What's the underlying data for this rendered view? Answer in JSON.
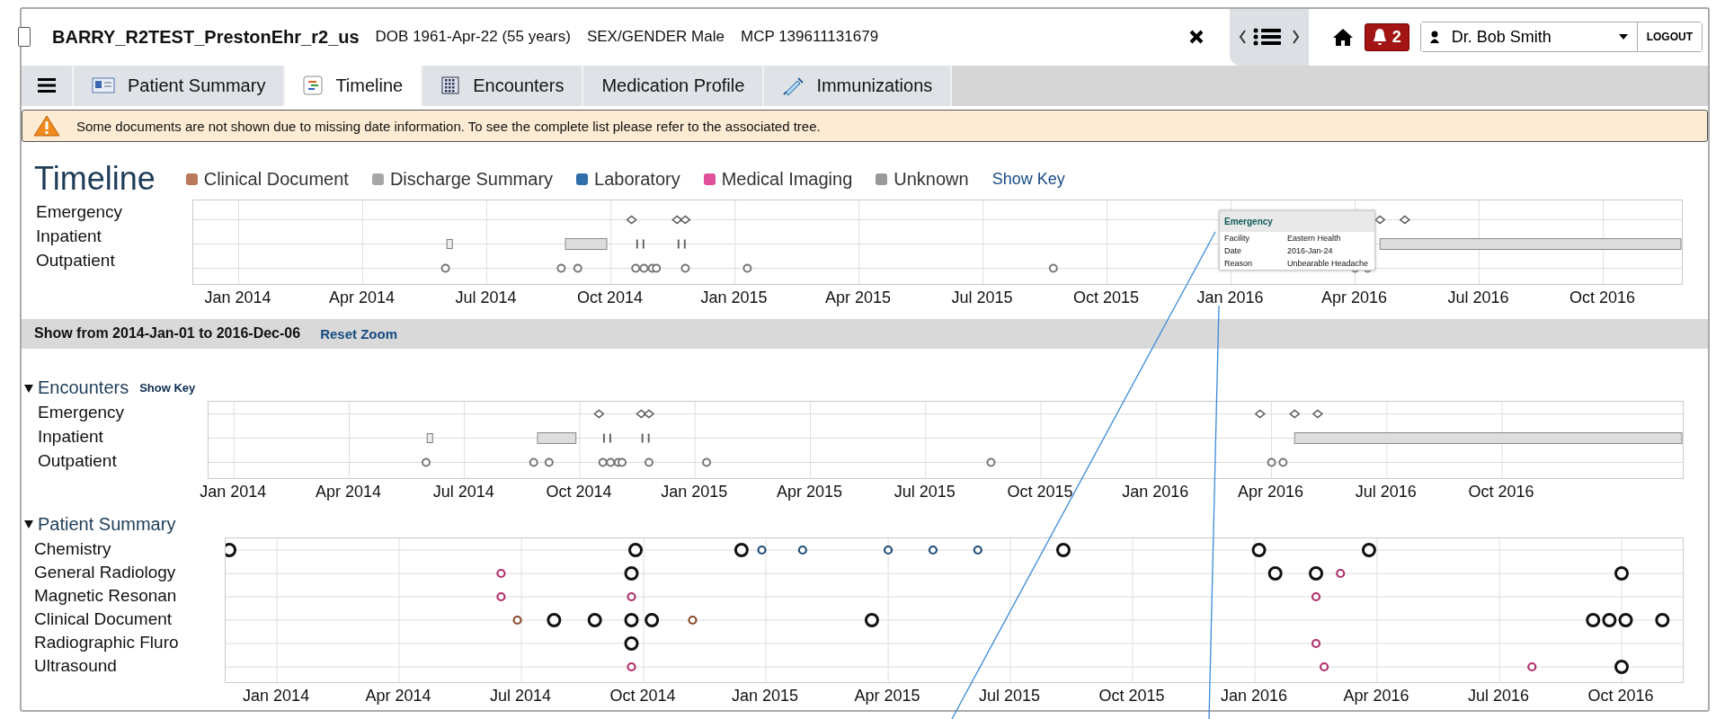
{
  "header": {
    "patient_name": "BARRY_R2TEST_PrestonEhr_r2_us",
    "details": [
      "DOB 1961-Apr-22 (55 years)",
      "SEX/GENDER Male",
      "MCP 139611131679"
    ],
    "alert_count": "2",
    "user": "Dr. Bob Smith",
    "logout": "LOGOUT"
  },
  "tabs": [
    {
      "label": "Patient Summary",
      "selected": false
    },
    {
      "label": "Timeline",
      "selected": true
    },
    {
      "label": "Encounters",
      "selected": false
    },
    {
      "label": "Medication Profile",
      "selected": false
    },
    {
      "label": "Immunizations",
      "selected": false
    }
  ],
  "banner": {
    "text": "Some documents are not shown due to missing date information. To see the complete list please refer to the associated tree."
  },
  "timeline": {
    "title": "Timeline",
    "legend": [
      {
        "label": "Clinical Document",
        "color": "#b9795a"
      },
      {
        "label": "Discharge Summary",
        "color": "#a6a6a6"
      },
      {
        "label": "Laboratory",
        "color": "#2f6ea8"
      },
      {
        "label": "Medical Imaging",
        "color": "#e0509a"
      },
      {
        "label": "Unknown",
        "color": "#999999"
      }
    ],
    "show_key": "Show Key",
    "rows": [
      "Emergency",
      "Inpatient",
      "Outpatient"
    ],
    "axis_labels": [
      "Jan 2014",
      "Apr 2014",
      "Jul 2014",
      "Oct 2014",
      "Jan 2015",
      "Apr 2015",
      "Jul 2015",
      "Oct 2015",
      "Jan 2016",
      "Apr 2016",
      "Jul 2016",
      "Oct 2016"
    ],
    "tooltip": {
      "title": "Emergency",
      "rows": [
        {
          "label": "Facility",
          "value": "Eastern Health"
        },
        {
          "label": "Date",
          "value": "2016-Jan-24"
        },
        {
          "label": "Reason",
          "value": "Unbearable Headache"
        }
      ]
    }
  },
  "zoom_bar": {
    "range": "Show from 2014-Jan-01 to 2016-Dec-06",
    "reset": "Reset Zoom"
  },
  "encounters": {
    "title": "Encounters",
    "expanded": true,
    "show_key": "Show Key",
    "rows": [
      "Emergency",
      "Inpatient",
      "Outpatient"
    ],
    "axis_labels": [
      "Jan 2014",
      "Apr 2014",
      "Jul 2014",
      "Oct 2014",
      "Jan 2015",
      "Apr 2015",
      "Jul 2015",
      "Oct 2015",
      "Jan 2016",
      "Apr 2016",
      "Jul 2016",
      "Oct 2016"
    ]
  },
  "patient_summary": {
    "title": "Patient Summary",
    "expanded": true,
    "rows": [
      "Chemistry",
      "General Radiology",
      "Magnetic Resonan",
      "Clinical Document",
      "Radiographic Fluro",
      "Ultrasound"
    ],
    "axis_labels": [
      "Jan 2014",
      "Apr 2014",
      "Jul 2014",
      "Oct 2014",
      "Jan 2015",
      "Apr 2015",
      "Jul 2015",
      "Oct 2015",
      "Jan 2016",
      "Apr 2016",
      "Jul 2016",
      "Oct 2016"
    ]
  }
}
